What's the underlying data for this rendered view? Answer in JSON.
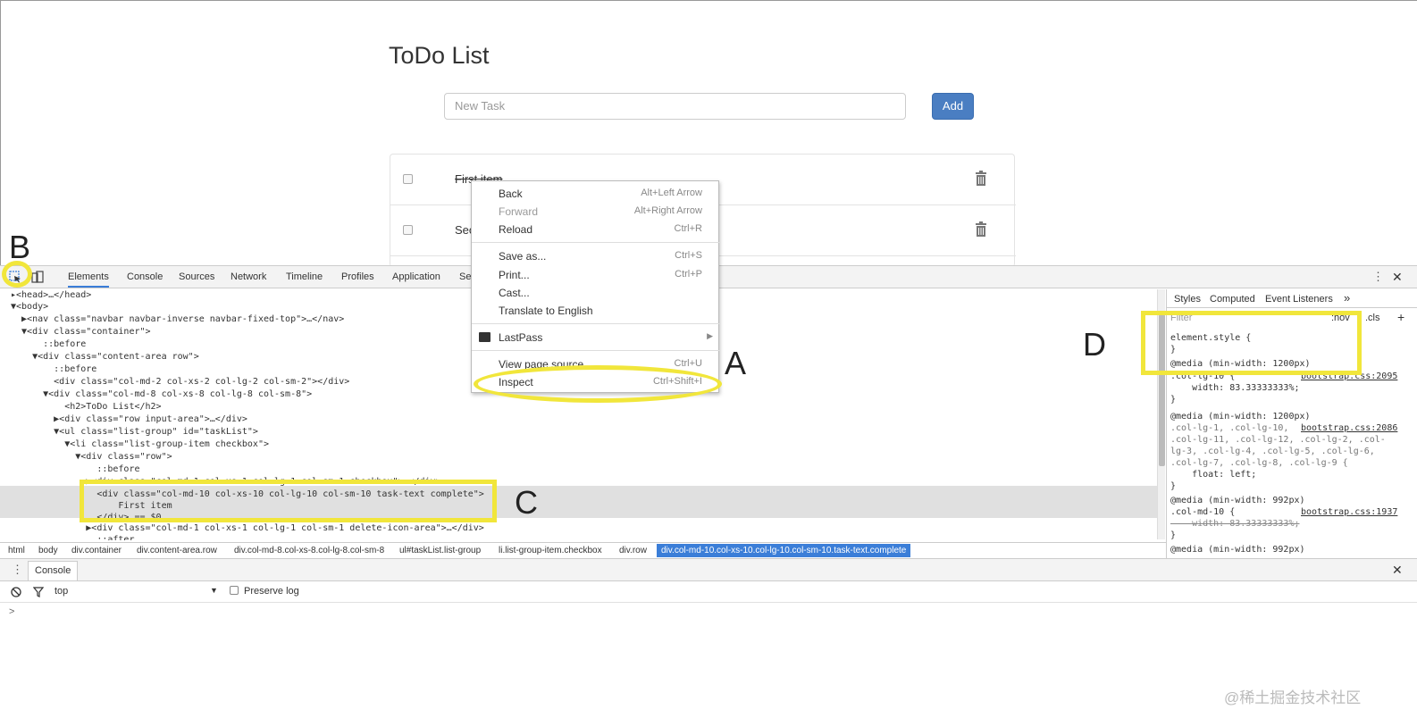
{
  "page": {
    "title": "ToDo List",
    "new_task_placeholder": "New Task",
    "add_label": "Add",
    "items": [
      {
        "text": "First item",
        "done": true
      },
      {
        "text": "Sec",
        "done": false
      }
    ]
  },
  "context_menu": {
    "items": [
      {
        "label": "Back",
        "shortcut": "Alt+Left Arrow",
        "disabled": false
      },
      {
        "label": "Forward",
        "shortcut": "Alt+Right Arrow",
        "disabled": true
      },
      {
        "label": "Reload",
        "shortcut": "Ctrl+R",
        "disabled": false
      },
      {
        "label": "Save as...",
        "shortcut": "Ctrl+S",
        "disabled": false
      },
      {
        "label": "Print...",
        "shortcut": "Ctrl+P",
        "disabled": false
      },
      {
        "label": "Cast...",
        "shortcut": "",
        "disabled": false
      },
      {
        "label": "Translate to English",
        "shortcut": "",
        "disabled": false
      },
      {
        "label": "LastPass",
        "shortcut": "",
        "disabled": false
      },
      {
        "label": "View page source",
        "shortcut": "Ctrl+U",
        "disabled": false
      },
      {
        "label": "Inspect",
        "shortcut": "Ctrl+Shift+I",
        "disabled": false
      }
    ]
  },
  "devtools": {
    "tabs": [
      "Elements",
      "Console",
      "Sources",
      "Network",
      "Timeline",
      "Profiles",
      "Application",
      "Se"
    ],
    "active_tab": "Elements",
    "dom_lines": [
      "▸<head>…</head>",
      "▼<body>",
      "  ▶<nav class=\"navbar navbar-inverse navbar-fixed-top\">…</nav>",
      "  ▼<div class=\"container\">",
      "      ::before",
      "    ▼<div class=\"content-area row\">",
      "        ::before",
      "        <div class=\"col-md-2 col-xs-2 col-lg-2 col-sm-2\"></div>",
      "      ▼<div class=\"col-md-8 col-xs-8 col-lg-8 col-sm-8\">",
      "          <h2>ToDo List</h2>",
      "        ▶<div class=\"row input-area\">…</div>",
      "        ▼<ul class=\"list-group\" id=\"taskList\">",
      "          ▼<li class=\"list-group-item checkbox\">",
      "            ▼<div class=\"row\">",
      "                ::before",
      "              ▶<div class=\"col-md-1 col-xs-1 col-lg-1 col-sm-1 checkbox\">…</div>",
      "                <div class=\"col-md-10 col-xs-10 col-lg-10 col-sm-10 task-text complete\">",
      "                    First item",
      "                </div> == $0",
      "              ▶<div class=\"col-md-1 col-xs-1 col-lg-1 col-sm-1 delete-icon-area\">…</div>",
      "                ::after"
    ],
    "breadcrumbs": [
      "html",
      "body",
      "div.container",
      "div.content-area.row",
      "div.col-md-8.col-xs-8.col-lg-8.col-sm-8",
      "ul#taskList.list-group",
      "li.list-group-item.checkbox",
      "div.row",
      "div.col-md-10.col-xs-10.col-lg-10.col-sm-10.task-text.complete"
    ],
    "styles_tabs": [
      "Styles",
      "Computed",
      "Event Listeners",
      "»"
    ],
    "filter_label": "Filter",
    "hov_label": ":hov",
    "cls_label": ".cls",
    "style_lines": [
      "element.style {",
      "}",
      "@media (min-width: 1200px)",
      ".col-lg-10 {",
      "    width: 83.33333333%;",
      "}",
      "@media (min-width: 1200px)",
      ".col-lg-1, .col-lg-10,",
      ".col-lg-11, .col-lg-12, .col-lg-2, .col-",
      "lg-3, .col-lg-4, .col-lg-5, .col-lg-6,",
      ".col-lg-7, .col-lg-8, .col-lg-9 {",
      "    float: left;",
      "}",
      "@media (min-width: 992px)",
      ".col-md-10 {",
      "    width: 83.33333333%;",
      "}",
      "@media (min-width: 992px)"
    ],
    "style_links": [
      "bootstrap.css:2095",
      "bootstrap.css:2086",
      "bootstrap.css:1937"
    ],
    "drawer_tab": "Console",
    "console_context": "top",
    "preserve_log": "Preserve log",
    "prompt": ">"
  },
  "annotations": {
    "a": "A",
    "b": "B",
    "c": "C",
    "d": "D"
  },
  "watermark": "@稀土掘金技术社区",
  "colors": {
    "highlight": "#f1e63b",
    "accent": "#3b7ed8",
    "button": "#4a7ec2"
  }
}
